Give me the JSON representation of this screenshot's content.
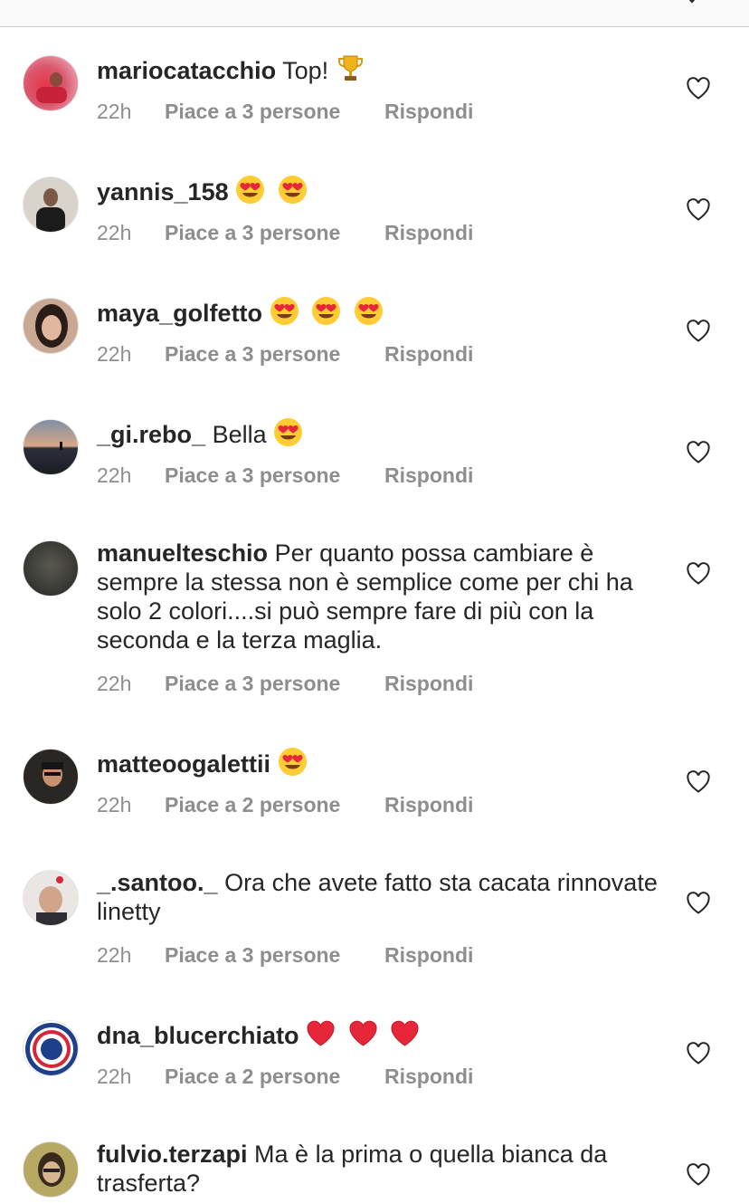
{
  "comments": [
    {
      "username": "mariocatacchio",
      "text": "Top!",
      "emoji": [
        "trophy"
      ],
      "time": "22h",
      "likes": "Piace a 3 persone",
      "reply": "Rispondi"
    },
    {
      "username": "yannis_158",
      "text": "",
      "emoji": [
        "heart-eyes",
        "heart-eyes"
      ],
      "time": "22h",
      "likes": "Piace a 3 persone",
      "reply": "Rispondi"
    },
    {
      "username": "maya_golfetto",
      "text": "",
      "emoji": [
        "heart-eyes",
        "heart-eyes",
        "heart-eyes"
      ],
      "time": "22h",
      "likes": "Piace a 3 persone",
      "reply": "Rispondi"
    },
    {
      "username": "_gi.rebo_",
      "text": "Bella",
      "emoji": [
        "heart-eyes"
      ],
      "time": "22h",
      "likes": "Piace a 3 persone",
      "reply": "Rispondi"
    },
    {
      "username": "manuelteschio",
      "text": "Per quanto possa cambiare è sempre la stessa non è semplice come per chi ha solo 2 colori....si può sempre fare di più con la seconda e la terza maglia.",
      "emoji": [],
      "time": "22h",
      "likes": "Piace a 3 persone",
      "reply": "Rispondi"
    },
    {
      "username": "matteoogalettii",
      "text": "",
      "emoji": [
        "heart-eyes"
      ],
      "time": "22h",
      "likes": "Piace a 2 persone",
      "reply": "Rispondi"
    },
    {
      "username": "_.santoo._",
      "text": "Ora che avete fatto sta cacata rinnovate linetty",
      "emoji": [],
      "time": "22h",
      "likes": "Piace a 3 persone",
      "reply": "Rispondi"
    },
    {
      "username": "dna_blucerchiato",
      "text": "",
      "emoji": [
        "red-heart",
        "red-heart",
        "red-heart"
      ],
      "time": "22h",
      "likes": "Piace a 2 persone",
      "reply": "Rispondi"
    },
    {
      "username": "fulvio.terzapi",
      "text": "Ma è la prima o quella bianca da trasferta?",
      "emoji": [],
      "time": "",
      "likes": "",
      "reply": ""
    }
  ],
  "icons": {
    "like": "heart-outline-icon",
    "top_right": "chevron-down-icon"
  }
}
